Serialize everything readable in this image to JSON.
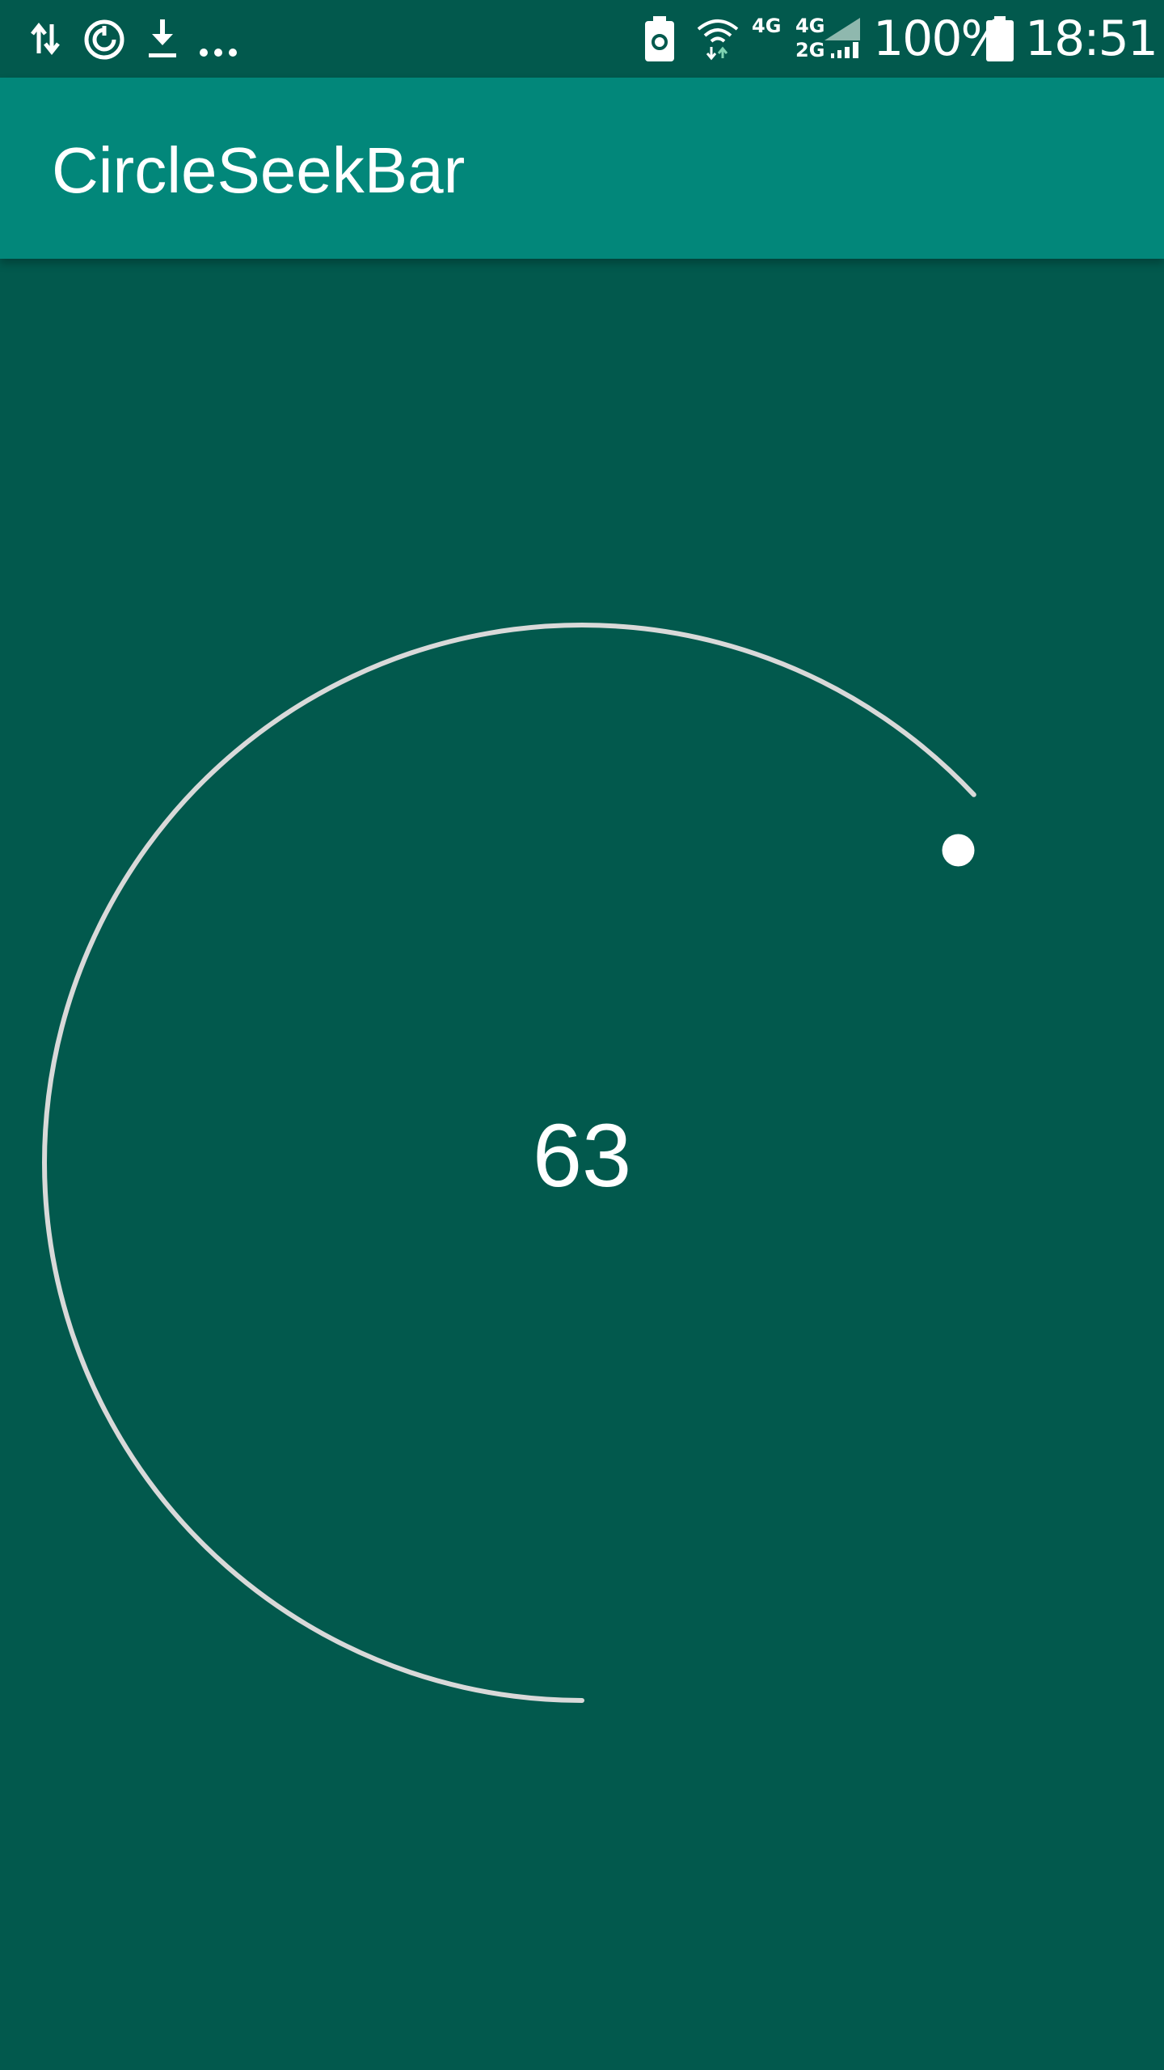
{
  "status_bar": {
    "icons_left": [
      "data-transfer-icon",
      "sync-icon",
      "download-icon",
      "more-notifications-icon"
    ],
    "icons_right": [
      "battery-saver-icon",
      "wifi-icon",
      "signal-icon",
      "battery-icon"
    ],
    "net_4g_a": "4G",
    "net_4g_b": "4G",
    "net_2g": "2G",
    "battery_percent": "100%",
    "time": "18:51"
  },
  "app_bar": {
    "title": "CircleSeekBar",
    "color": "#02877a"
  },
  "seekbar": {
    "value": "63",
    "progress": 63,
    "track_color": "#d9d9d9",
    "thumb_color": "#ffffff",
    "background_color": "#02594d"
  }
}
